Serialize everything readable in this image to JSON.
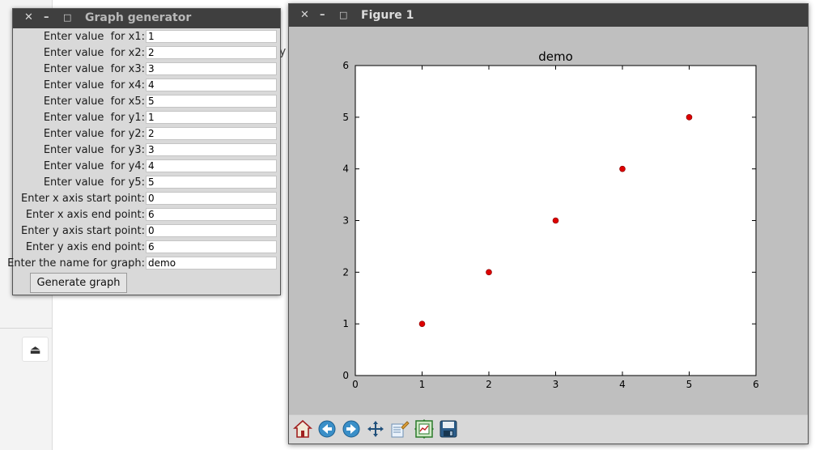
{
  "background": {
    "eject_glyph": "⏏",
    "fragment_text": "y"
  },
  "generator_window": {
    "title": "Graph generator",
    "controls": {
      "close": "✕",
      "minimize": "–",
      "maximize": "□"
    },
    "fields": [
      {
        "label": "Enter value  for x1:",
        "value": "1"
      },
      {
        "label": "Enter value  for x2:",
        "value": "2"
      },
      {
        "label": "Enter value  for x3:",
        "value": "3"
      },
      {
        "label": "Enter value  for x4:",
        "value": "4"
      },
      {
        "label": "Enter value  for x5:",
        "value": "5"
      },
      {
        "label": "Enter value  for y1:",
        "value": "1"
      },
      {
        "label": "Enter value  for y2:",
        "value": "2"
      },
      {
        "label": "Enter value  for y3:",
        "value": "3"
      },
      {
        "label": "Enter value  for y4:",
        "value": "4"
      },
      {
        "label": "Enter value  for y5:",
        "value": "5"
      },
      {
        "label": "Enter x axis start point:",
        "value": "0"
      },
      {
        "label": "Enter x axis end point:",
        "value": "6"
      },
      {
        "label": "Enter y axis start point:",
        "value": "0"
      },
      {
        "label": "Enter y axis end point:",
        "value": "6"
      },
      {
        "label": "Enter the name for graph:",
        "value": "demo"
      }
    ],
    "generate_label": "Generate graph"
  },
  "figure_window": {
    "title": "Figure 1",
    "controls": {
      "close": "✕",
      "minimize": "–",
      "maximize": "□"
    },
    "toolbar_icons": [
      "home-icon",
      "back-arrow-icon",
      "forward-arrow-icon",
      "pan-move-icon",
      "zoom-rect-icon",
      "subplots-config-icon",
      "save-disk-icon"
    ],
    "colors": {
      "marker": "#dd0000",
      "figure_bg": "#bfbfbf",
      "axes_bg": "#ffffff"
    }
  },
  "chart_data": {
    "type": "scatter",
    "title": "demo",
    "x": [
      1,
      2,
      3,
      4,
      5
    ],
    "y": [
      1,
      2,
      3,
      4,
      5
    ],
    "xlim": [
      0,
      6
    ],
    "ylim": [
      0,
      6
    ],
    "xticks": [
      "0",
      "1",
      "2",
      "3",
      "4",
      "5",
      "6"
    ],
    "yticks": [
      "0",
      "1",
      "2",
      "3",
      "4",
      "5",
      "6"
    ],
    "xlabel": "",
    "ylabel": "",
    "grid": false,
    "marker_color": "#dd0000"
  }
}
